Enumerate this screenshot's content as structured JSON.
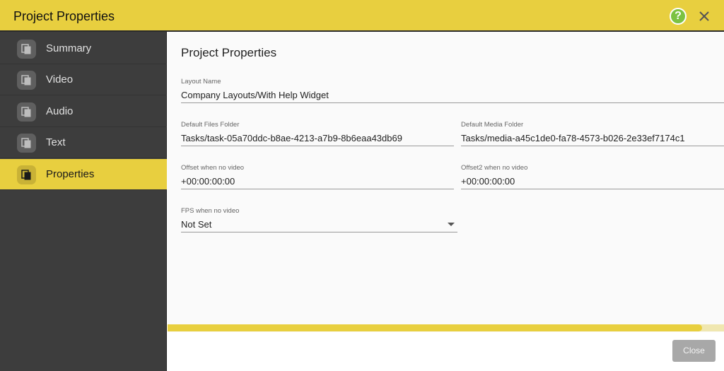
{
  "window": {
    "title": "Project Properties",
    "help_label": "?"
  },
  "sidebar": {
    "items": [
      {
        "label": "Summary",
        "icon": "copy-icon",
        "active": false
      },
      {
        "label": "Video",
        "icon": "copy-icon",
        "active": false
      },
      {
        "label": "Audio",
        "icon": "copy-icon",
        "active": false
      },
      {
        "label": "Text",
        "icon": "copy-icon",
        "active": false
      },
      {
        "label": "Properties",
        "icon": "copy-icon",
        "active": true
      }
    ]
  },
  "main": {
    "title": "Project Properties",
    "fields": {
      "layout_name": {
        "label": "Layout Name",
        "value": "Company Layouts/With Help Widget"
      },
      "default_files_folder": {
        "label": "Default Files Folder",
        "value": "Tasks/task-05a70ddc-b8ae-4213-a7b9-8b6eaa43db69"
      },
      "default_media_folder": {
        "label": "Default Media Folder",
        "value": "Tasks/media-a45c1de0-fa78-4573-b026-2e33ef7174c1"
      },
      "offset_no_video": {
        "label": "Offset when no video",
        "value": "+00:00:00:00"
      },
      "offset2_no_video": {
        "label": "Offset2 when no video",
        "value": "+00:00:00:00"
      },
      "fps_no_video": {
        "label": "FPS when no video",
        "value": "Not Set"
      }
    },
    "progress": 0.96
  },
  "footer": {
    "close_label": "Close"
  },
  "colors": {
    "accent": "#e8cf3f",
    "sidebar_bg": "#3d3d3d",
    "help_green": "#7cc242"
  }
}
